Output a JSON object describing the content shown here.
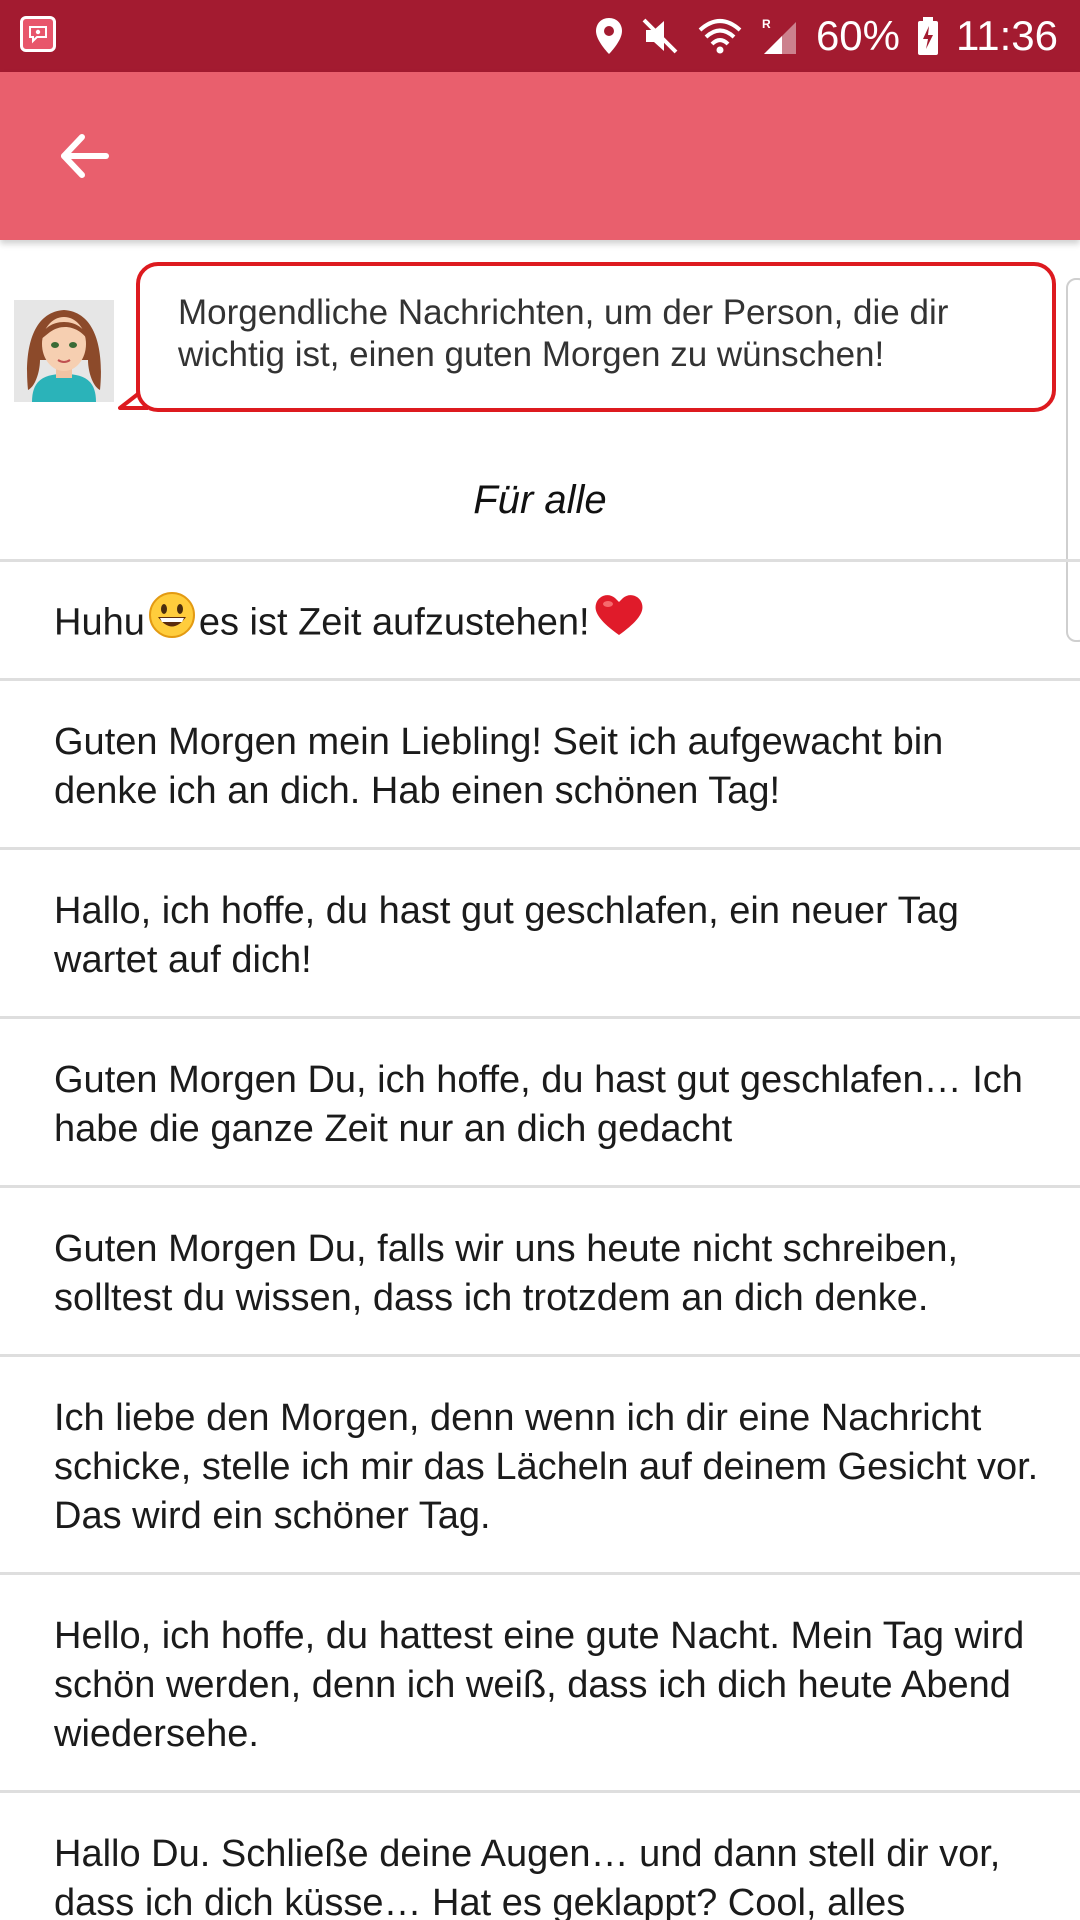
{
  "status_bar": {
    "battery": "60%",
    "time": "11:36",
    "icons": [
      "message-app-icon",
      "location-icon",
      "mute-icon",
      "wifi-icon",
      "signal-icon",
      "battery-icon"
    ]
  },
  "app_bar": {
    "title": "",
    "back_icon": "arrow-left-icon"
  },
  "intro": {
    "text": "Morgendliche Nachrichten, um der Person, die dir wichtig ist, einen guten Morgen zu wünschen!",
    "bubble_border_color": "#dd1a1f"
  },
  "section": {
    "title": "Für alle"
  },
  "messages": [
    {
      "before": "Huhu",
      "middle": "es ist Zeit aufzustehen!",
      "emojis": [
        "grinning-face-emoji",
        "red-heart-emoji"
      ]
    },
    {
      "text": "Guten Morgen mein Liebling! Seit ich aufgewacht bin denke ich an dich. Hab einen schönen Tag!"
    },
    {
      "text": "Hallo, ich hoffe, du hast gut geschlafen, ein neuer Tag wartet auf dich!"
    },
    {
      "text": "Guten Morgen Du, ich hoffe, du hast gut geschlafen… Ich habe die ganze Zeit nur an dich gedacht"
    },
    {
      "text": "Guten Morgen Du, falls wir uns heute nicht schreiben, solltest du wissen, dass ich trotzdem an dich denke."
    },
    {
      "text": "Ich liebe den Morgen, denn wenn ich dir eine Nachricht schicke, stelle ich mir das Lächeln auf deinem Gesicht vor. Das wird ein schöner Tag."
    },
    {
      "text": "Hello, ich hoffe, du hattest eine gute Nacht. Mein Tag wird schön werden, denn ich weiß, dass ich dich heute Abend wiedersehe."
    },
    {
      "text": "Hallo Du. Schließe deine Augen… und dann stell dir vor, dass ich dich küsse… Hat es geklappt? Cool, alles"
    }
  ],
  "colors": {
    "status_bar": "#a31b30",
    "app_bar": "#e95f6d",
    "divider": "#dedede"
  }
}
